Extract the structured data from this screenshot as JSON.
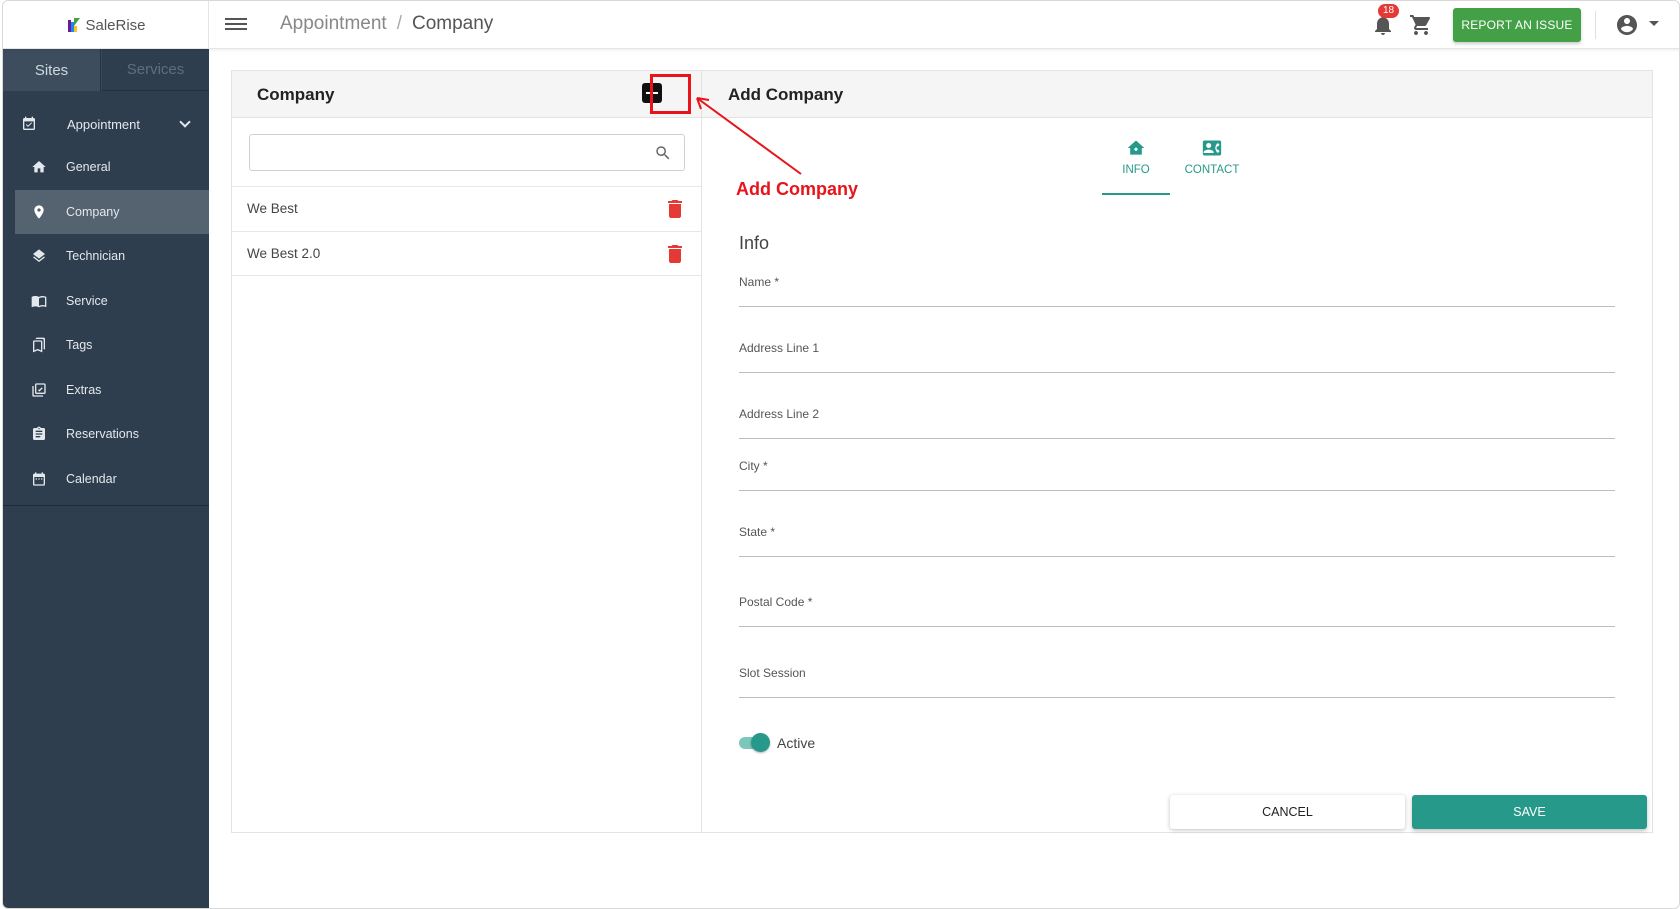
{
  "topbar": {
    "logo_text": "SaleRise",
    "breadcrumb": [
      "Appointment",
      "Company"
    ],
    "breadcrumb_sep": "/",
    "notification_count": "18",
    "report_label": "REPORT AN ISSUE",
    "report_color": "#43a047"
  },
  "sidebar": {
    "tabs": [
      {
        "label": "Sites",
        "active": true
      },
      {
        "label": "Services",
        "active": false
      }
    ],
    "group": {
      "label": "Appointment",
      "icon": "calendar-check-icon"
    },
    "items": [
      {
        "label": "General",
        "icon": "home-icon"
      },
      {
        "label": "Company",
        "icon": "location-pin-icon",
        "active": true
      },
      {
        "label": "Technician",
        "icon": "layers-icon"
      },
      {
        "label": "Service",
        "icon": "book-icon"
      },
      {
        "label": "Tags",
        "icon": "bookmark-icon"
      },
      {
        "label": "Extras",
        "icon": "library-add-icon"
      },
      {
        "label": "Reservations",
        "icon": "clipboard-icon"
      },
      {
        "label": "Calendar",
        "icon": "calendar-icon"
      }
    ],
    "bg_color": "#2f3e4e"
  },
  "list_panel": {
    "title": "Company",
    "search_value": "",
    "companies": [
      {
        "name": "We Best"
      },
      {
        "name": "We Best 2.0"
      }
    ]
  },
  "form_panel": {
    "title": "Add Company",
    "tabs": [
      {
        "label": "INFO",
        "icon": "home-icon",
        "active": true
      },
      {
        "label": "CONTACT",
        "icon": "contact-card-icon",
        "active": false
      }
    ],
    "section_title": "Info",
    "fields": {
      "name": {
        "label": "Name *",
        "value": ""
      },
      "address1": {
        "label": "Address Line 1",
        "value": ""
      },
      "address2": {
        "label": "Address Line 2",
        "value": ""
      },
      "city": {
        "label": "City *",
        "value": ""
      },
      "state": {
        "label": "State *",
        "value": ""
      },
      "postal": {
        "label": "Postal Code *",
        "value": ""
      },
      "slot": {
        "label": "Slot Session",
        "value": ""
      }
    },
    "active_label": "Active",
    "active_on": true,
    "cancel_label": "CANCEL",
    "save_label": "SAVE",
    "accent_color": "#26998a"
  },
  "annotation": {
    "text": "Add Company",
    "color": "#e8131b"
  }
}
